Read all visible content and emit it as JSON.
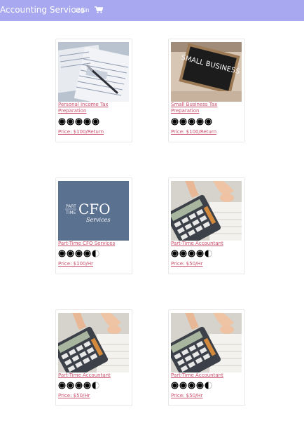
{
  "nav": {
    "brand": "Accounting Services",
    "login": "Login",
    "cart_icon": "shopping-cart-icon"
  },
  "products": [
    {
      "title": "Personal Income Tax Preparation",
      "rating": 5,
      "price": "Price: $100/Return",
      "image": "tax-forms-photo"
    },
    {
      "title": "Small Business Tax Preparation",
      "rating": 5,
      "price": "Price: $100/Return",
      "image": "small-business-chalkboard-photo",
      "image_text": "SMALL BUSINESS"
    },
    {
      "title": "Part-Time CFO Services",
      "rating": 4.5,
      "price": "Price: $100/Hr",
      "image": "part-time-cfo-logo",
      "logo_small1": "PART",
      "logo_small2": "TIME",
      "logo_big": "CFO",
      "logo_script": "Services"
    },
    {
      "title": "Part-Time Accountant",
      "rating": 4.5,
      "price": "Price: $50/Hr",
      "image": "calculator-photo"
    },
    {
      "title": "Part-Time Accountant",
      "rating": 4.5,
      "price": "Price: $50/Hr",
      "image": "calculator-photo"
    },
    {
      "title": "Part-Time Accountant",
      "rating": 4.5,
      "price": "Price: $50/Hr",
      "image": "calculator-photo"
    }
  ],
  "colors": {
    "navbar": "#a8a8f0",
    "link": "#c9506c",
    "cfo_background": "#5b7190"
  }
}
